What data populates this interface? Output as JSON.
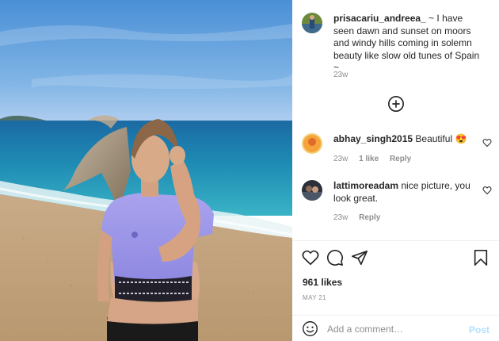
{
  "post": {
    "author": "prisacariu_andreea_",
    "caption": "~ I have seen dawn and sunset on moors and windy hills coming in solemn beauty like slow old tunes of Spain ~",
    "time": "23w"
  },
  "comments": [
    {
      "user": "abhay_singh2015",
      "text": "Beautiful 😍",
      "time": "23w",
      "likes": "1 like",
      "reply": "Reply"
    },
    {
      "user": "lattimoreadam",
      "text": "nice picture, you look great.",
      "time": "23w",
      "reply": "Reply"
    }
  ],
  "likes": "961 likes",
  "date": "MAY 21",
  "add_comment": {
    "placeholder": "Add a comment…",
    "post_label": "Post"
  },
  "icons": [
    "plus-circle-icon",
    "heart-icon",
    "comment-icon",
    "share-icon",
    "bookmark-icon",
    "emoji-icon"
  ],
  "colors": {
    "link_blue_disabled": "#b2dffc",
    "muted": "#8e8e8e",
    "text": "#262626"
  }
}
